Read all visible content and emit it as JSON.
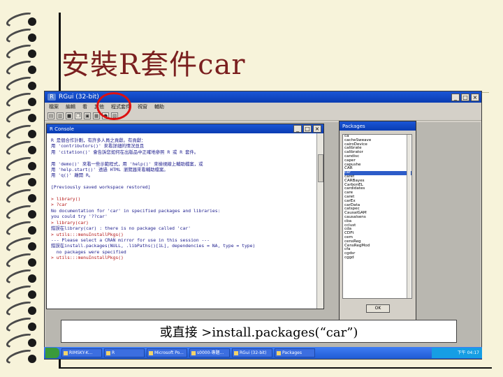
{
  "slide": {
    "title": "安裝R套件car",
    "caption": "或直接 >install.packages(“car”)"
  },
  "rgui": {
    "title": "RGui (32-bit)",
    "menu": [
      "檔案",
      "編輯",
      "看",
      "其他",
      "程式套件",
      "視窗",
      "輔助"
    ],
    "console": {
      "title": "R Console",
      "lines": [
        "R 是個合作計劃，有許多人員之貢獻。有貢獻：",
        "用 'contributors()' 來看詳細的情況並且",
        "用 'citation()' 會告訴您如何在出版品中正確地參照 R 或 R 套件。",
        "",
        "用 'demo()' 來看一些示範程式，用 'help()' 來檢視線上輔助檔案，或",
        "用 'help.start()' 透過 HTML 瀏覽器來看輔助檔案。",
        "用 'q()' 離開 R。",
        "",
        "[Previously saved workspace restored]",
        "",
        "> library()",
        "> ?car",
        "No documentation for 'car' in specified packages and libraries:",
        "you could try '??car'",
        "> library(car)",
        "錯誤在library(car) : there is no package called 'car'",
        "> utils:::menuInstallPkgs()",
        "--- Please select a CRAN mirror for use in this session ---",
        "錯誤在install.packages(NULL, .libPaths()[1L], dependencies = NA, type = type)",
        "  no packages were specified",
        "> utils:::menuInstallPkgs()"
      ]
    },
    "packages": {
      "title": "Packages",
      "items": [
        "ca",
        "cacheSweave",
        "cairoDevice",
        "calibrate",
        "calibrator",
        "candisc",
        "caper",
        "capushe",
        "CAR",
        "car",
        "caret",
        "CARBayes",
        "CarbonEL",
        "cardidates",
        "care",
        "caret",
        "carEx",
        "carData",
        "catspec",
        "CausalGAM",
        "causalsens",
        "cba",
        "cclust",
        "cda",
        "CDFt",
        "cem",
        "censReg",
        "CensRegMod",
        "cfa",
        "cgdsr",
        "cggd"
      ],
      "selected_index": 9,
      "ok_label": "OK"
    }
  },
  "taskbar": {
    "items": [
      "RIMSKY-K...",
      "R",
      "Microsoft Po...",
      "s0000-專題...",
      "RGui (32-bit)",
      "Packages"
    ],
    "clock": "下午 04:17"
  }
}
